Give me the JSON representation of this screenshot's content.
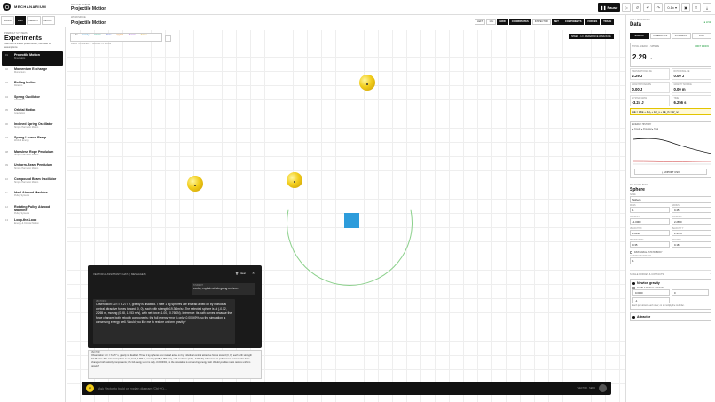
{
  "app": {
    "brand": "MECHANARIUM",
    "nav": [
      "BUILD",
      "LAB",
      "LEARN",
      "APPLY"
    ],
    "nav_active": 1
  },
  "crumb": {
    "l1": "ACTIVE SCENE",
    "l2": "Projectile Motion"
  },
  "toolbar": {
    "pause": "Pause",
    "zoom": "0.1x"
  },
  "sidebar": {
    "section": "PREBUILT SYSTEMS",
    "title": "Experiments",
    "desc": "Start with a known phenomenon, then alter its assumptions",
    "items": [
      {
        "n": "01",
        "t": "Projectile Motion",
        "s": "Kinematics",
        "active": true
      },
      {
        "n": "02",
        "t": "Momentum Exchange",
        "s": "Momentum"
      },
      {
        "n": "03",
        "t": "Rolling Incline",
        "s": "Rotation"
      },
      {
        "n": "04",
        "t": "Spring Oscillator",
        "s": "Oscillation"
      },
      {
        "n": "05",
        "t": "Orbital Motion",
        "s": "Gravitation"
      },
      {
        "n": "06",
        "t": "Inclined Spring Oscillator",
        "s": "Simple Harmonic Motion"
      },
      {
        "n": "07",
        "t": "Spring Launch Ramp",
        "s": "Work & Energy"
      },
      {
        "n": "08",
        "t": "Massless Rope Pendulum",
        "s": "Simple Harmonic Motion"
      },
      {
        "n": "09",
        "t": "Uniform-Beam Pendulum",
        "s": "Simple Harmonic Motion"
      },
      {
        "n": "10",
        "t": "Compound Beam Oscillator",
        "s": "Simple Harmonic Motion"
      },
      {
        "n": "11",
        "t": "Ideal Atwood Machine",
        "s": "Pulley Systems"
      },
      {
        "n": "12",
        "t": "Rotating Pulley Atwood Machine",
        "s": "Pulley Systems"
      },
      {
        "n": "13",
        "t": "Loop-the-Loop",
        "s": "Energy & Circular Motion"
      }
    ]
  },
  "canvas": {
    "label": "WORKSPACE",
    "title": "Projectile Motion",
    "legend": [
      "● Vel",
      "— Gravity",
      "— Friction",
      "— Norm",
      "— Applied",
      "— Tension",
      "— Forces"
    ],
    "hint": "DRAG TO INSPECT · SCROLL TO ZOOM",
    "bar": [
      "LEFT",
      "1.0x",
      "GRID",
      "COORDINATES",
      "INSPECTOR"
    ],
    "bar2": [
      "SET",
      "COMPONENTS",
      "FORCES",
      "TRACE"
    ],
    "speed": "SPEED · 1.0 · REFERENCE WAVE RATE"
  },
  "chat": {
    "header": "VECTOR AI ASSISTANT CHAT (2 MESSAGES)",
    "clear": "Clear",
    "user_who": "STUDENT",
    "user_text": "vector, explain whats going on here.",
    "ai_who": "VECTOR AI",
    "ai_text": "Observation: At t = 6.277 s, gravity is disabled. Three 1 kg spheres are instead acted on by individual central attractive forces toward (0, 0), each with strength 19.36 m/s². The selected sphere is at (-0.12, 2.265 m, moving (0.98, 1.953 m/s), with net force (1.00, -0.760 N). Inference: its path curves because the force changes both velocity components; the full energy error is only -0.00049%, so the simulation is conserving energy well. Would you like me to restore uniform gravity?"
  },
  "note": {
    "who": "VECTOR",
    "text": "Observation: At t = 6.277 s, gravity is disabled. Three 1 kg spheres are instead acted on by individual central attractive forces toward (0, 0), each with strength 19.36 m/s². The selected sphere is at (-0.12, 2.265 m, moving (0.98, 1.953 m/s), with net force (1.00, -0.760 N). Inference: its path curves because the force changes both velocity components; the full energy error is only -0.00049%, so the simulation is conserving energy well. Would you like me to restore uniform gravity?"
  },
  "prompt": {
    "placeholder": "Ask Vector to build or explain diagram (Ctrl+K)...",
    "tag": "VECTOR · SEND"
  },
  "data": {
    "section": "LIVE LABORATORY",
    "title": "Data",
    "live": "● LIVE",
    "tabs": [
      "ENERGY",
      "KINEMATICS",
      "DYNAMICS",
      "LOG"
    ],
    "total_label": "TOTAL ENERGY · SPHERE",
    "total": "2.29",
    "total_unit": "J",
    "drift": "DRIFT 0.000%",
    "cells": [
      {
        "k": "TRANSLATIONAL KE",
        "v": "2.29 J"
      },
      {
        "k": "ROTATIONAL KE",
        "v": "0.00 J"
      },
      {
        "k": "GRAVITATIONAL PE",
        "v": "0.00 J"
      },
      {
        "k": "GRAVITY SOURCE",
        "v": "0.00 m"
      },
      {
        "k": "SYSTEM MASS",
        "v": "-3.24 J"
      },
      {
        "k": "TIME",
        "v": "6.256 s"
      }
    ],
    "eq": "ΔE = ΔKE + ΔU₉ + ΔU_s + ΔE_th = W_nc",
    "hist": "ENERGY HISTORY",
    "hist_legend": "● Kinetic  ● Potential  ● Total",
    "export": "EXPORT CSV",
    "sel_section": "SELECTED BODY",
    "sel_title": "Sphere",
    "name_k": "NAME",
    "name_v": "Sphere",
    "props": [
      {
        "k": "MASS",
        "v": "1"
      },
      {
        "k": "RADIUS",
        "v": "0.45"
      },
      {
        "k": "CENTER X",
        "v": "-1.0000"
      },
      {
        "k": "CENTER Y",
        "v": "2.2650"
      },
      {
        "k": "VELOCITY X",
        "v": "1.8434"
      },
      {
        "k": "VELOCITY Y",
        "v": "1.9704"
      },
      {
        "k": "RESTITUTION",
        "v": "0.35"
      },
      {
        "k": "FRICTION",
        "v": "0.18"
      }
    ],
    "chk": "IMMOVABLE / STATIC BODY",
    "vis_k": "GRAVITY MULTIPLIER",
    "vis_v": "1",
    "forces_sec": "SINGLE FORCES & CONTACTS",
    "f1": "Newton gravity",
    "f1chk": "ENABLE MUTUAL GRAVITY",
    "f1a": "0.0000",
    "f1b": "0",
    "f1c": "-1",
    "f1note": "Each pair attracts each other; on or multiply the multiplier.",
    "f2": "Attractor"
  }
}
